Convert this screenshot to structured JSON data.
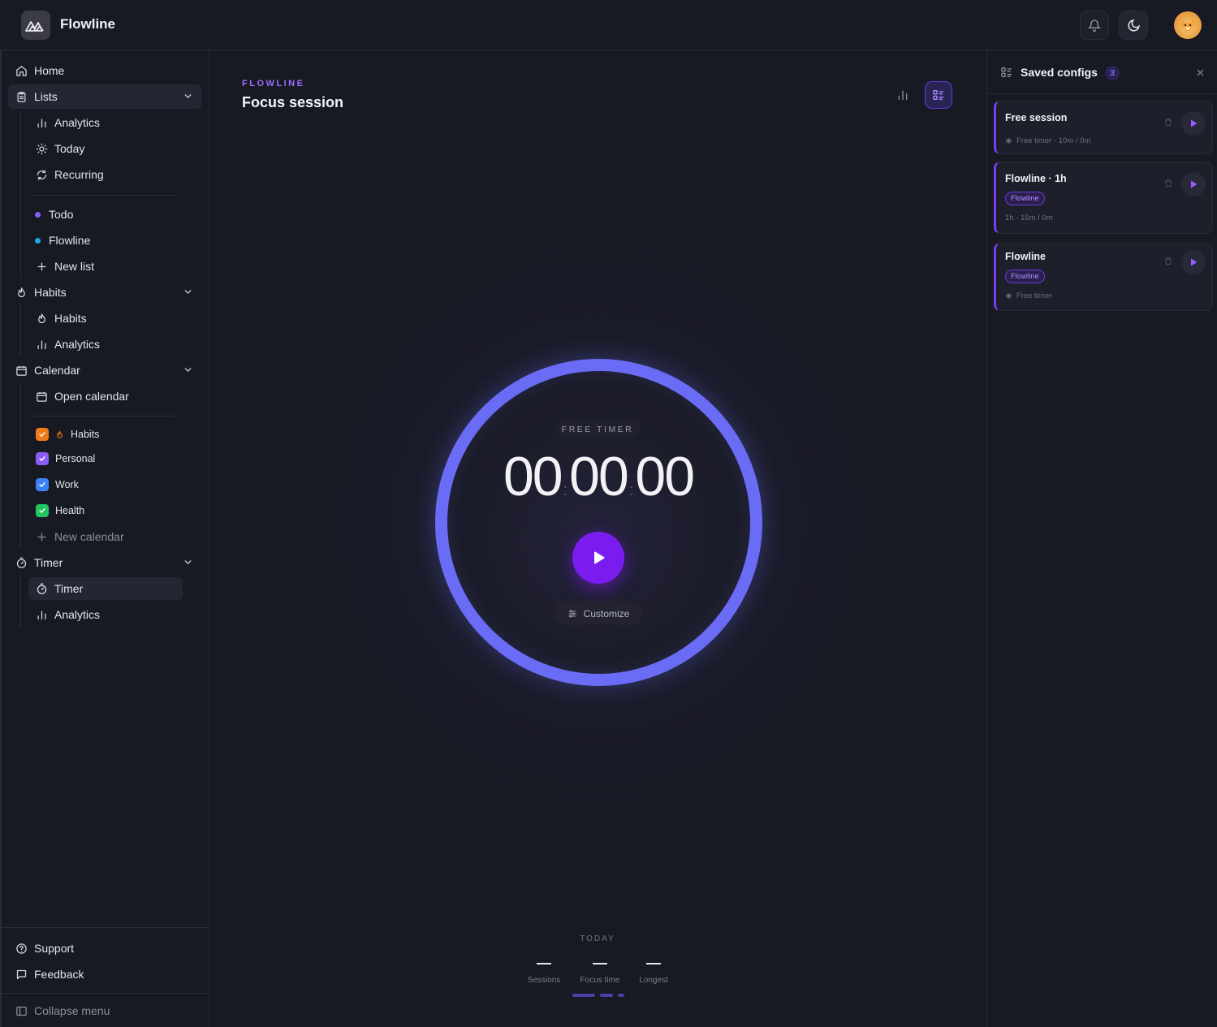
{
  "app": {
    "name": "Flowline"
  },
  "sidebar": {
    "home": "Home",
    "lists": {
      "label": "Lists",
      "analytics": "Analytics",
      "today": "Today",
      "recurring": "Recurring",
      "todo": "Todo",
      "flowline": "Flowline",
      "new_list": "New list"
    },
    "habits": {
      "label": "Habits",
      "habits": "Habits",
      "analytics": "Analytics"
    },
    "calendar": {
      "label": "Calendar",
      "open": "Open calendar",
      "calendars": [
        {
          "name": "Habits",
          "color": "#f07a1a"
        },
        {
          "name": "Personal",
          "color": "#8b5cf6"
        },
        {
          "name": "Work",
          "color": "#3b82f6"
        },
        {
          "name": "Health",
          "color": "#22c55e"
        }
      ],
      "new_calendar": "New calendar"
    },
    "timer": {
      "label": "Timer",
      "timer": "Timer",
      "analytics": "Analytics"
    },
    "support": "Support",
    "feedback": "Feedback",
    "collapse": "Collapse menu"
  },
  "main": {
    "eyebrow": "FLOWLINE",
    "title": "Focus session",
    "mode_label": "FREE TIMER",
    "time": {
      "h": "00",
      "m": "00",
      "s": "00",
      "sep": ":"
    },
    "customize": "Customize",
    "today": {
      "label": "TODAY",
      "stats": [
        {
          "label": "Sessions",
          "value": "—"
        },
        {
          "label": "Focus time",
          "value": "—"
        },
        {
          "label": "Longest",
          "value": "—"
        }
      ]
    }
  },
  "panel": {
    "title": "Saved configs",
    "count": "3",
    "configs": [
      {
        "title": "Free session",
        "tag": "",
        "meta": "Free timer · 10m / 0m"
      },
      {
        "title": "Flowline · 1h",
        "tag": "Flowline",
        "meta": "1h · 15m / 0m"
      },
      {
        "title": "Flowline",
        "tag": "Flowline",
        "meta": "Free timer"
      }
    ]
  },
  "colors": {
    "accent": "#7a1cf0",
    "ring": "#6a6cf6",
    "eyebrow": "#9f6bff"
  }
}
